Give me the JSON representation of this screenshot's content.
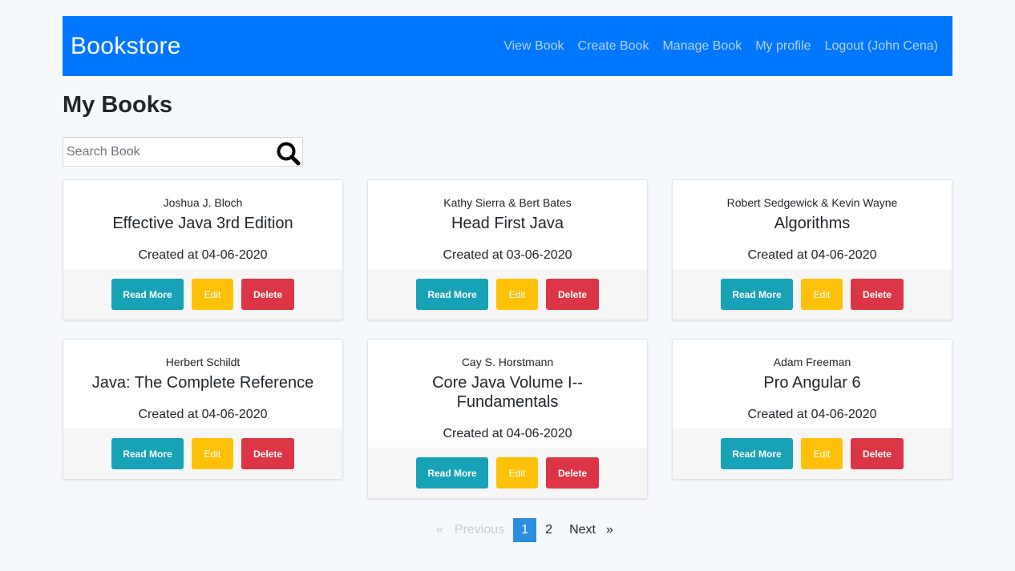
{
  "navbar": {
    "brand": "Bookstore",
    "links": [
      "View Book",
      "Create Book",
      "Manage Book",
      "My profile",
      "Logout (John Cena)"
    ],
    "color": "#0077ff"
  },
  "page": {
    "title": "My Books"
  },
  "search": {
    "placeholder": "Search Book",
    "value": "",
    "icon": "search-icon"
  },
  "books": [
    {
      "author": "Joshua J. Bloch",
      "title": "Effective Java 3rd Edition",
      "created": "Created at 04-06-2020"
    },
    {
      "author": "Kathy Sierra & Bert Bates",
      "title": "Head First Java",
      "created": "Created at 03-06-2020"
    },
    {
      "author": "Robert Sedgewick & Kevin Wayne",
      "title": "Algorithms",
      "created": "Created at 04-06-2020"
    },
    {
      "author": "Herbert Schildt",
      "title": "Java: The Complete Reference",
      "created": "Created at 04-06-2020"
    },
    {
      "author": "Cay S. Horstmann",
      "title": "Core Java Volume I--Fundamentals",
      "created": "Created at 04-06-2020"
    },
    {
      "author": "Adam Freeman",
      "title": "Pro Angular 6",
      "created": "Created at 04-06-2020"
    }
  ],
  "buttons": {
    "read_more": "Read More",
    "edit": "Edit",
    "delete": "Delete"
  },
  "pagination": {
    "prev_arrow": "«",
    "previous": "Previous",
    "pages": [
      "1",
      "2"
    ],
    "current": "1",
    "next": "Next",
    "next_arrow": "»"
  }
}
